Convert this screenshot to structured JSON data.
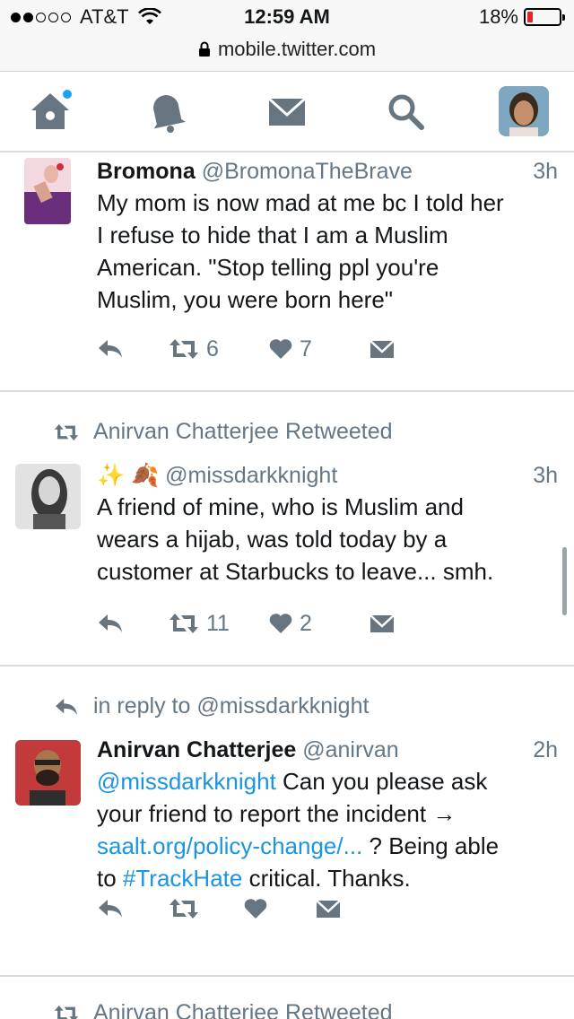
{
  "status_bar": {
    "carrier": "AT&T",
    "time": "12:59 AM",
    "battery": "18%",
    "battery_level": 0.18,
    "url": "mobile.twitter.com"
  },
  "nav": {
    "items": [
      {
        "name": "home",
        "icon": "home-icon",
        "has_notification": true
      },
      {
        "name": "notifications",
        "icon": "bell-icon"
      },
      {
        "name": "messages",
        "icon": "envelope-icon"
      },
      {
        "name": "search",
        "icon": "search-icon"
      },
      {
        "name": "profile",
        "icon": "avatar"
      }
    ]
  },
  "tweets": [
    {
      "fullname": "Bromona",
      "username": "@BromonaTheBrave",
      "time": "3h",
      "text_lines": [
        "My mom is now mad at me bc I told her",
        "I refuse to hide that I am a Muslim",
        "American. \"Stop telling ppl you're",
        "Muslim, you were born here\""
      ],
      "retweets": "6",
      "likes": "7"
    },
    {
      "context": "Anirvan Chatterjee Retweeted",
      "fullname": "✨ 🍂",
      "username": "@missdarkknight",
      "time": "3h",
      "text_lines": [
        "A friend of mine, who is Muslim and",
        "wears a hijab, was told today by a",
        "customer at Starbucks to leave... smh."
      ],
      "retweets": "11",
      "likes": "2"
    },
    {
      "context": "in reply to @missdarkknight",
      "fullname": "Anirvan Chatterjee",
      "username": "@anirvan",
      "time": "2h",
      "mention": "@missdarkknight",
      "text_1_rest": " Can you please ask",
      "text_2": "your friend to report the incident →",
      "link_url": "saalt.org/policy-change/...",
      "text_3_rest": " ? Being able",
      "text_4_pre": "to ",
      "hashtag": "#TrackHate",
      "text_4_rest": " critical. Thanks."
    },
    {
      "context": "Anirvan Chatterjee Retweeted"
    }
  ],
  "colors": {
    "link": "#1b95e0",
    "muted": "#657786",
    "icon": "#66757f",
    "notification": "#1da1f2"
  }
}
